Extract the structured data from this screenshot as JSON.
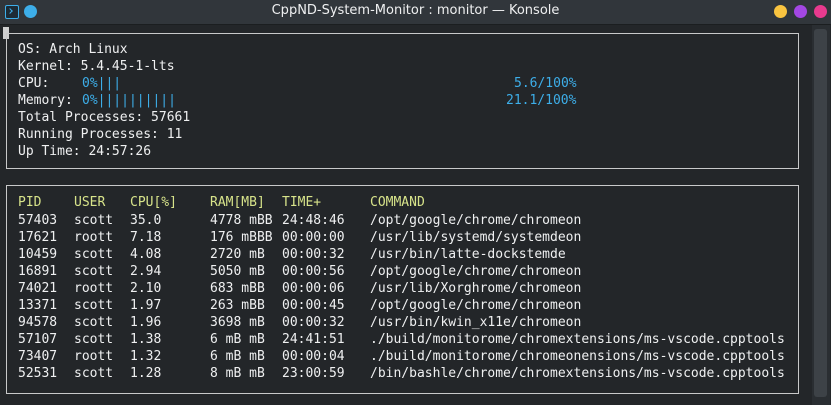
{
  "window": {
    "title": "CppND-System-Monitor : monitor — Konsole",
    "colors": {
      "pin": "#3daee9",
      "minimize": "#f9c440",
      "maximize": "#a347e3",
      "close": "#e83a8e"
    }
  },
  "system": {
    "os_line": "OS: Arch Linux",
    "kernel_line": "Kernel: 5.4.45-1-lts",
    "cpu_label": "CPU:",
    "cpu_bar": "0%|||",
    "cpu_value": "5.6/100%",
    "memory_label": "Memory:",
    "memory_bar": "0%||||||||||",
    "memory_value": "21.1/100%",
    "total_processes_line": "Total Processes: 57661",
    "running_processes_line": "Running Processes: 11",
    "uptime_line": "Up Time: 24:57:26",
    "cpu_percent": 5.6,
    "memory_percent": 21.1
  },
  "processes": {
    "columns": [
      "PID",
      "USER",
      "CPU[%]",
      "RAM[MB]",
      "TIME+",
      "COMMAND"
    ],
    "rows": [
      {
        "pid": "57403",
        "user": "scott",
        "cpu": "35.0",
        "ram": "4778 mBB",
        "time": "24:48:46",
        "command": "/opt/google/chrome/chromeon"
      },
      {
        "pid": "17621",
        "user": "roott",
        "cpu": "7.18",
        "ram": "176 mBBB",
        "time": "00:00:00",
        "command": "/usr/lib/systemd/systemdeon"
      },
      {
        "pid": "10459",
        "user": "scott",
        "cpu": "4.08",
        "ram": "2720 mB",
        "time": "00:00:32",
        "command": "/usr/bin/latte-dockstemde"
      },
      {
        "pid": "16891",
        "user": "scott",
        "cpu": "2.94",
        "ram": "5050 mB",
        "time": "00:00:56",
        "command": "/opt/google/chrome/chromeon"
      },
      {
        "pid": "74021",
        "user": "roott",
        "cpu": "2.10",
        "ram": "683 mBB",
        "time": "00:00:06",
        "command": "/usr/lib/Xorghrome/chromeon"
      },
      {
        "pid": "13371",
        "user": "scott",
        "cpu": "1.97",
        "ram": "263 mBB",
        "time": "00:00:45",
        "command": "/opt/google/chrome/chromeon"
      },
      {
        "pid": "94578",
        "user": "scott",
        "cpu": "1.96",
        "ram": "3698 mB",
        "time": "00:00:32",
        "command": "/usr/bin/kwin_x11e/chromeon"
      },
      {
        "pid": "57107",
        "user": "scott",
        "cpu": "1.38",
        "ram": "6 mB mB",
        "time": "24:41:51",
        "command": "./build/monitorome/chromextensions/ms-vscode.cpptools"
      },
      {
        "pid": "73407",
        "user": "roott",
        "cpu": "1.32",
        "ram": "6 mB mB",
        "time": "00:00:04",
        "command": "./build/monitorome/chromeonensions/ms-vscode.cpptools"
      },
      {
        "pid": "52531",
        "user": "scott",
        "cpu": "1.28",
        "ram": "8 mB mB",
        "time": "23:00:59",
        "command": "/bin/bashle/chrome/chromextensions/ms-vscode.cpptools"
      }
    ]
  }
}
